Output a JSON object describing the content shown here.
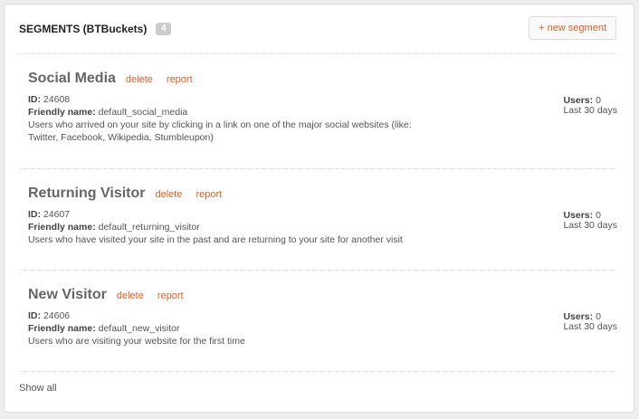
{
  "header": {
    "title": "SEGMENTS (BTBuckets)",
    "count": "4",
    "new_segment_label": "+ new segment"
  },
  "segments": [
    {
      "name": "Social Media",
      "delete_label": "delete",
      "report_label": "report",
      "id_label": "ID:",
      "id": "24608",
      "friendly_label": "Friendly name:",
      "friendly_name": "default_social_media",
      "description": "Users who arrived on your site by clicking in a link on one of the major social websites (like: Twitter, Facebook, Wikipedia, Stumbleupon)",
      "users_label": "Users:",
      "users": "0",
      "period": "Last 30 days"
    },
    {
      "name": "Returning Visitor",
      "delete_label": "delete",
      "report_label": "report",
      "id_label": "ID:",
      "id": "24607",
      "friendly_label": "Friendly name:",
      "friendly_name": "default_returning_visitor",
      "description": "Users who have visited your site in the past and are returning to your site for another visit",
      "users_label": "Users:",
      "users": "0",
      "period": "Last 30 days"
    },
    {
      "name": "New Visitor",
      "delete_label": "delete",
      "report_label": "report",
      "id_label": "ID:",
      "id": "24606",
      "friendly_label": "Friendly name:",
      "friendly_name": "default_new_visitor",
      "description": "Users who are visiting your website for the first time",
      "users_label": "Users:",
      "users": "0",
      "period": "Last 30 days"
    }
  ],
  "footer": {
    "show_all_label": "Show all"
  },
  "colors": {
    "link": "#e05f26",
    "badge": "#cccccc",
    "divider": "#dddddd"
  }
}
